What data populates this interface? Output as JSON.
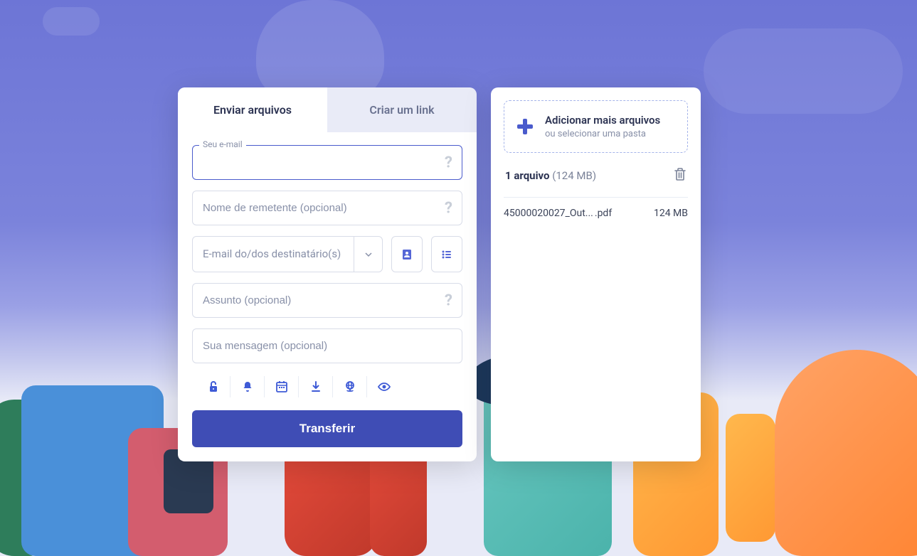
{
  "tabs": {
    "send_files": "Enviar arquivos",
    "create_link": "Criar um link"
  },
  "form": {
    "email_label": "Seu e-mail",
    "email_value": "",
    "sender_placeholder": "Nome de remetente (opcional)",
    "recipient_placeholder": "E-mail do/dos destinatário(s)",
    "subject_placeholder": "Assunto (opcional)",
    "message_placeholder": "Sua mensagem (opcional)"
  },
  "transfer_button": "Transferir",
  "files_panel": {
    "add_more_title": "Adicionar mais arquivos",
    "add_more_subtitle": "ou selecionar uma pasta",
    "count_label": "1 arquivo",
    "total_size": "(124 MB)",
    "file": {
      "name": "45000020027_Out...",
      "ext": ".pdf",
      "size": "124 MB"
    }
  },
  "icons": {
    "lock": "lock-icon",
    "bell": "bell-icon",
    "calendar": "calendar-icon",
    "download": "download-icon",
    "globe": "globe-icon",
    "eye": "eye-icon",
    "contact": "contact-icon",
    "list": "list-icon"
  },
  "colors": {
    "primary": "#3f4db5",
    "accent": "#5566d6"
  }
}
